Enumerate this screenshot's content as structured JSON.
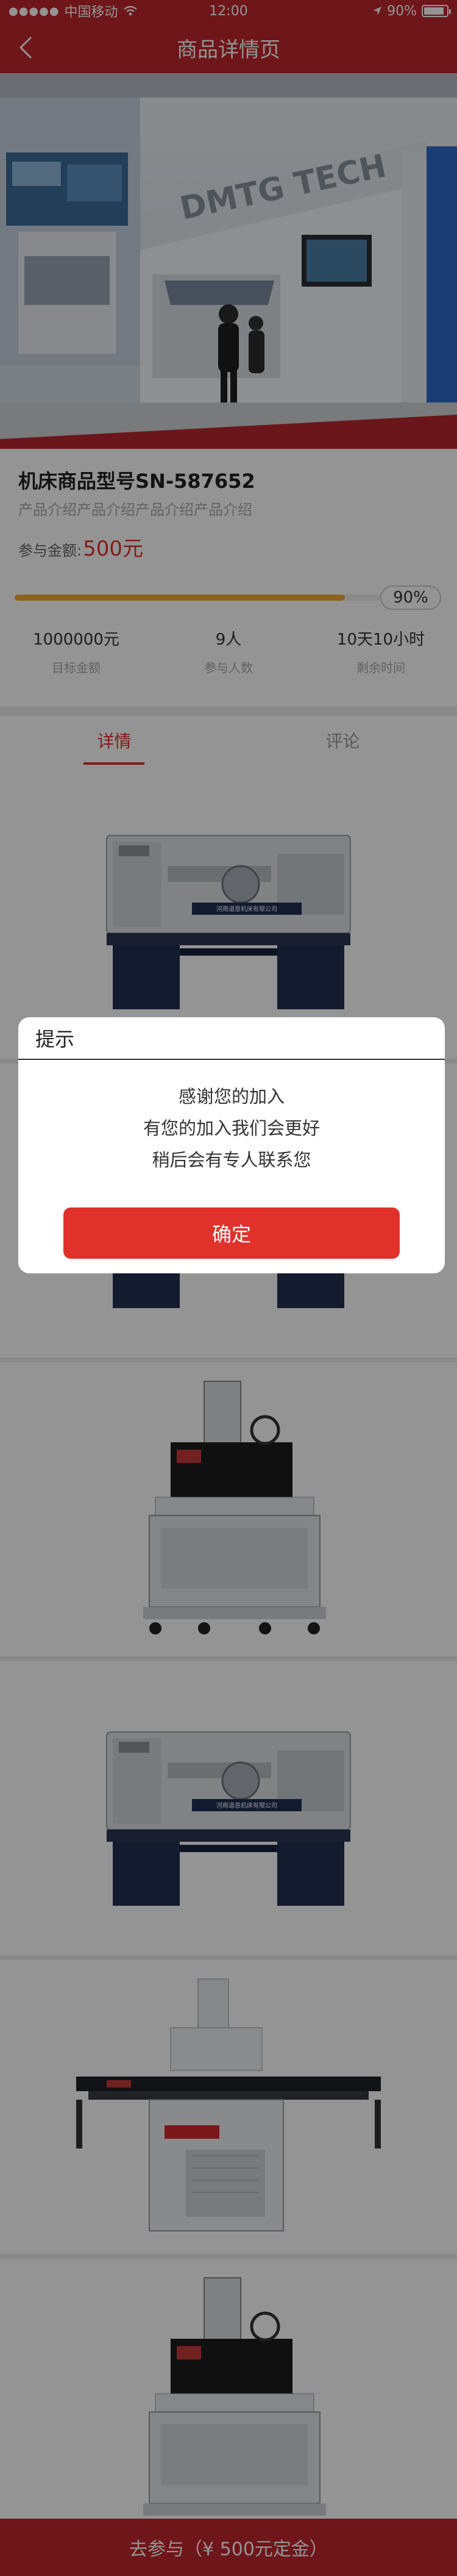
{
  "status_bar": {
    "carrier": "中国移动",
    "time": "12:00",
    "battery": "90%",
    "battery_level": 0.9
  },
  "nav": {
    "title": "商品详情页"
  },
  "hero": {
    "sign_text": "DMTG TECH"
  },
  "product": {
    "name": "机床商品型号SN-587652",
    "description": "产品介绍产品介绍产品介绍产品介绍",
    "amount_label": "参与金额:",
    "amount_value": "500元",
    "progress_percent": 90,
    "progress_label": "90%",
    "stats": [
      {
        "value": "1000000元",
        "label": "目标金额"
      },
      {
        "value": "9人",
        "label": "参与人数"
      },
      {
        "value": "10天10小时",
        "label": "剩余时间"
      }
    ]
  },
  "tabs": [
    {
      "label": "详情",
      "active": true
    },
    {
      "label": "评论",
      "active": false
    }
  ],
  "gallery": [
    {
      "type": "lathe"
    },
    {
      "type": "lathe"
    },
    {
      "type": "edm"
    },
    {
      "type": "lathe"
    },
    {
      "type": "conveyor"
    },
    {
      "type": "edm"
    }
  ],
  "lathe_plate": "河南道恩机床有限公司",
  "bottom_bar": {
    "label": "去参与（¥ 500元定金）"
  },
  "dialog": {
    "title": "提示",
    "lines": [
      "感谢您的加入",
      "有您的加入我们会更好",
      "稍后会有专人联系您"
    ],
    "confirm_label": "确定"
  },
  "colors": {
    "brand_red": "#c0272d",
    "accent_red": "#e0322b",
    "progress_orange": "#f4a934"
  }
}
